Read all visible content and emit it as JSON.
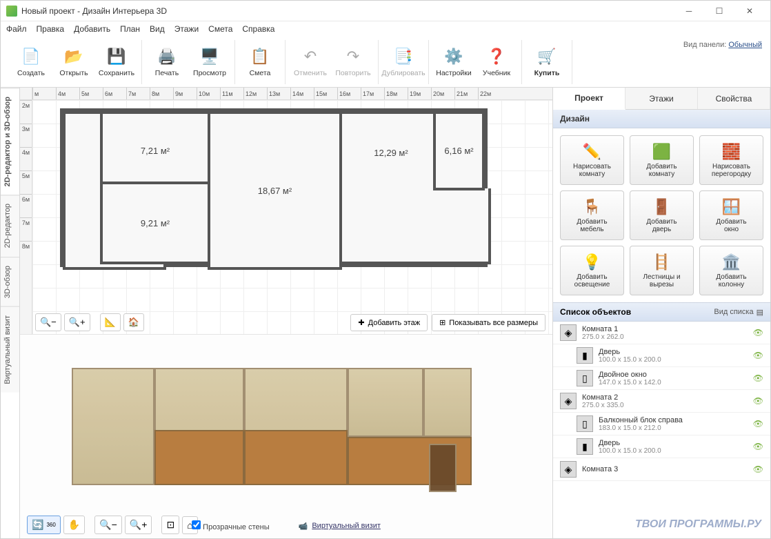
{
  "window": {
    "title": "Новый проект - Дизайн Интерьера 3D"
  },
  "menu": [
    "Файл",
    "Правка",
    "Добавить",
    "План",
    "Вид",
    "Этажи",
    "Смета",
    "Справка"
  ],
  "panel_mode": {
    "label": "Вид панели:",
    "value": "Обычный"
  },
  "toolbar": {
    "create": "Создать",
    "open": "Открыть",
    "save": "Сохранить",
    "print": "Печать",
    "preview": "Просмотр",
    "estimate": "Смета",
    "undo": "Отменить",
    "redo": "Повторить",
    "duplicate": "Дублировать",
    "settings": "Настройки",
    "tutorial": "Учебник",
    "buy": "Купить"
  },
  "ruler_h": [
    "м",
    "4м",
    "5м",
    "6м",
    "7м",
    "8м",
    "9м",
    "10м",
    "11м",
    "12м",
    "13м",
    "14м",
    "15м",
    "16м",
    "17м",
    "18м",
    "19м",
    "20м",
    "21м",
    "22м"
  ],
  "ruler_v": [
    "2м",
    "3м",
    "4м",
    "5м",
    "6м",
    "7м",
    "8м"
  ],
  "side_tabs": {
    "t2d3d": "2D-редактор и 3D-обзор",
    "t2d": "2D-редактор",
    "t3d": "3D-обзор",
    "tvr": "Виртуальный визит"
  },
  "rooms": {
    "r2": "7,21 м²",
    "r3": "9,21 м²",
    "r4": "18,67 м²",
    "r5": "12,29 м²",
    "r6": "6,16 м²"
  },
  "plan_buttons": {
    "add_floor": "Добавить этаж",
    "show_dims": "Показывать все размеры"
  },
  "viewer": {
    "transparent": "Прозрачные стены",
    "visit": "Виртуальный визит"
  },
  "rp_tabs": {
    "project": "Проект",
    "floors": "Этажи",
    "props": "Свойства"
  },
  "design_header": "Дизайн",
  "design_buttons": {
    "draw_room_l1": "Нарисовать",
    "draw_room_l2": "комнату",
    "add_room_l1": "Добавить",
    "add_room_l2": "комнату",
    "draw_wall_l1": "Нарисовать",
    "draw_wall_l2": "перегородку",
    "add_furn_l1": "Добавить",
    "add_furn_l2": "мебель",
    "add_door_l1": "Добавить",
    "add_door_l2": "дверь",
    "add_window_l1": "Добавить",
    "add_window_l2": "окно",
    "add_light_l1": "Добавить",
    "add_light_l2": "освещение",
    "stairs_l1": "Лестницы и",
    "stairs_l2": "вырезы",
    "add_col_l1": "Добавить",
    "add_col_l2": "колонну"
  },
  "objects_header": "Список объектов",
  "view_list": "Вид списка",
  "objects": [
    {
      "name": "Комната 1",
      "dim": "275.0 x 262.0",
      "icon": "◈",
      "child": false
    },
    {
      "name": "Дверь",
      "dim": "100.0 x 15.0 x 200.0",
      "icon": "▮",
      "child": true
    },
    {
      "name": "Двойное окно",
      "dim": "147.0 x 15.0 x 142.0",
      "icon": "▯",
      "child": true
    },
    {
      "name": "Комната 2",
      "dim": "275.0 x 335.0",
      "icon": "◈",
      "child": false
    },
    {
      "name": "Балконный блок справа",
      "dim": "183.0 x 15.0 x 212.0",
      "icon": "▯",
      "child": true
    },
    {
      "name": "Дверь",
      "dim": "100.0 x 15.0 x 200.0",
      "icon": "▮",
      "child": true
    },
    {
      "name": "Комната 3",
      "dim": "",
      "icon": "◈",
      "child": false
    }
  ],
  "watermark": "ТВОИ ПРОГРАММЫ.РУ"
}
